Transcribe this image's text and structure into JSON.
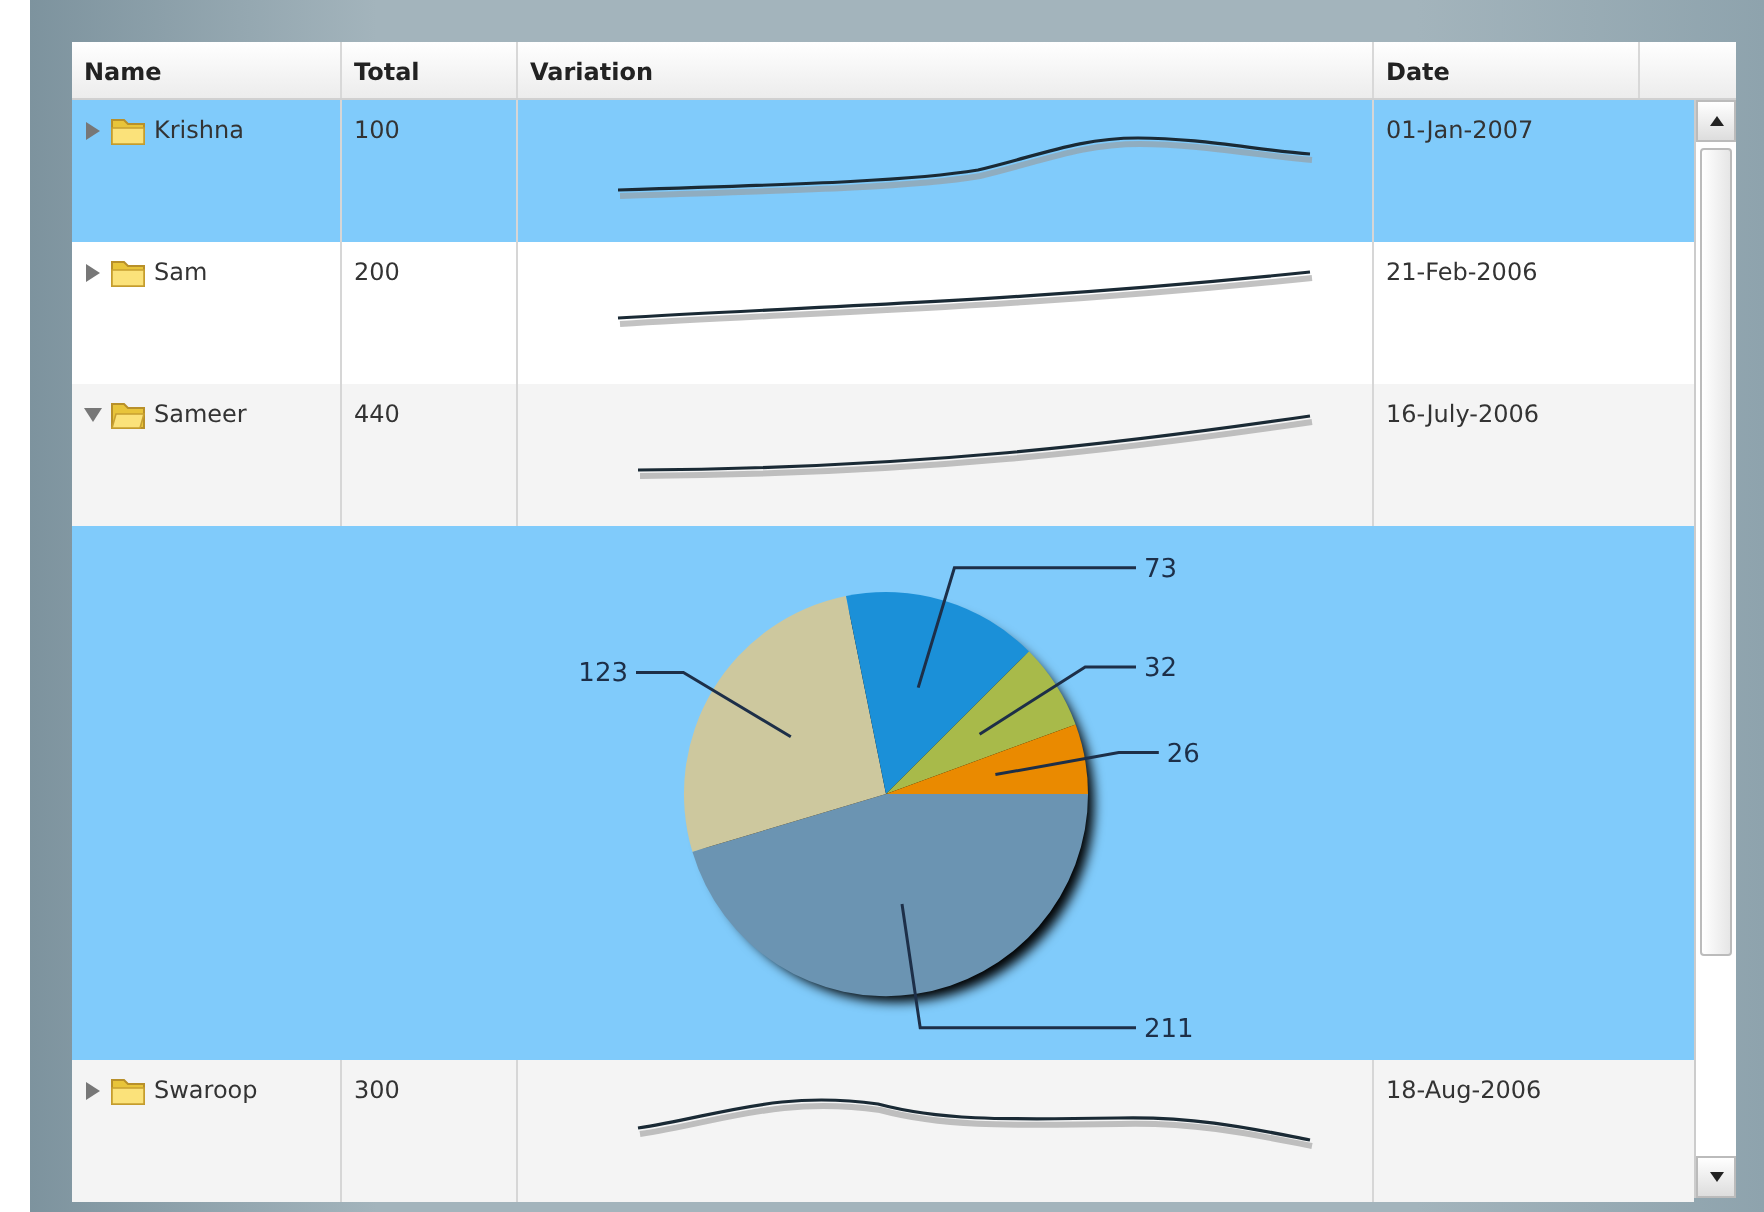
{
  "table": {
    "columns": [
      "Name",
      "Total",
      "Variation",
      "Date"
    ],
    "rows": [
      {
        "name": "Krishna",
        "total": "100",
        "date": "01-Jan-2007",
        "selected": true,
        "expanded": false
      },
      {
        "name": "Sam",
        "total": "200",
        "date": "21-Feb-2006",
        "selected": false,
        "expanded": false
      },
      {
        "name": "Sameer",
        "total": "440",
        "date": "16-July-2006",
        "selected": false,
        "expanded": true,
        "detail": {
          "chart_data": {
            "type": "pie",
            "values": [
              211,
              123,
              73,
              32,
              26
            ],
            "colors": [
              "#6b94b2",
              "#cdc89e",
              "#1b90d8",
              "#a8ba4a",
              "#ea8a00"
            ],
            "data_labels": true
          }
        }
      },
      {
        "name": "Swaroop",
        "total": "300",
        "date": "18-Aug-2006",
        "selected": false,
        "expanded": false
      }
    ]
  }
}
